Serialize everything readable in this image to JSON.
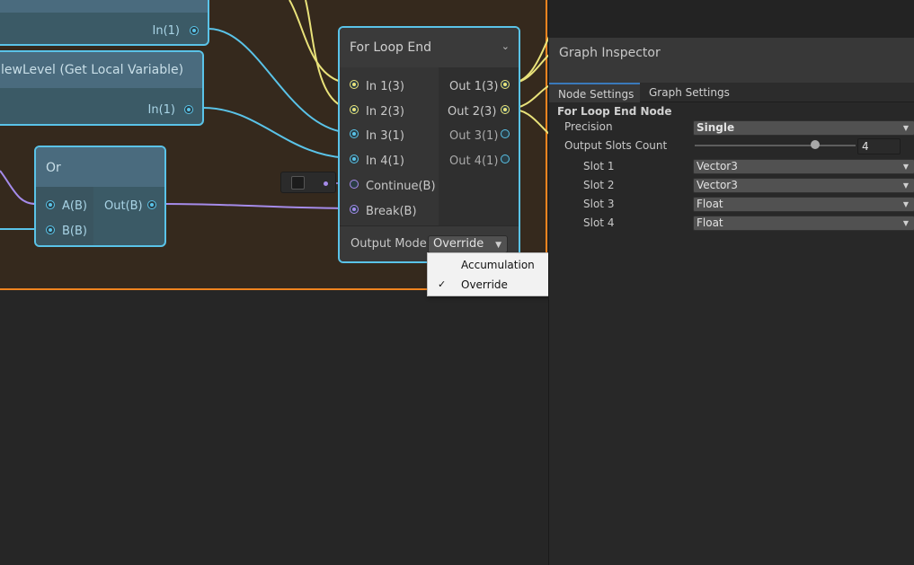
{
  "colors": {
    "group_border": "#f0831e",
    "node_border": "#5ac3e8",
    "wire_yellow": "#e9e27a",
    "wire_cyan": "#5ac3e8",
    "wire_purple": "#a58bea",
    "tab_active": "#3a79bb"
  },
  "nodes": {
    "top_partial": {
      "port_label": "In(1)"
    },
    "get_local": {
      "title": "lewLevel (Get Local Variable)",
      "port_label": "In(1)"
    },
    "or_node": {
      "title": "Or",
      "inputs": [
        "A(B)",
        "B(B)"
      ],
      "output": "Out(B)"
    },
    "for_loop_end": {
      "title": "For Loop End",
      "inputs": [
        "In 1(3)",
        "In 2(3)",
        "In 3(1)",
        "In 4(1)",
        "Continue(B)",
        "Break(B)"
      ],
      "outputs": [
        "Out 1(3)",
        "Out 2(3)",
        "Out 3(1)",
        "Out 4(1)"
      ],
      "output_mode_label": "Output Mode",
      "output_mode_value": "Override"
    }
  },
  "popup": {
    "items": [
      {
        "label": "Accumulation",
        "checked": false
      },
      {
        "label": "Override",
        "checked": true
      }
    ],
    "check_glyph": "✓"
  },
  "inspector": {
    "title": "Graph Inspector",
    "tabs": [
      "Node Settings",
      "Graph Settings"
    ],
    "section": "For Loop End Node",
    "precision_label": "Precision",
    "precision_value": "Single",
    "slots_count_label": "Output Slots Count",
    "slots_count_value": "4",
    "slots_count_fraction": 0.75,
    "slots": [
      {
        "label": "Slot 1",
        "value": "Vector3"
      },
      {
        "label": "Slot 2",
        "value": "Vector3"
      },
      {
        "label": "Slot 3",
        "value": "Float"
      },
      {
        "label": "Slot 4",
        "value": "Float"
      }
    ]
  }
}
